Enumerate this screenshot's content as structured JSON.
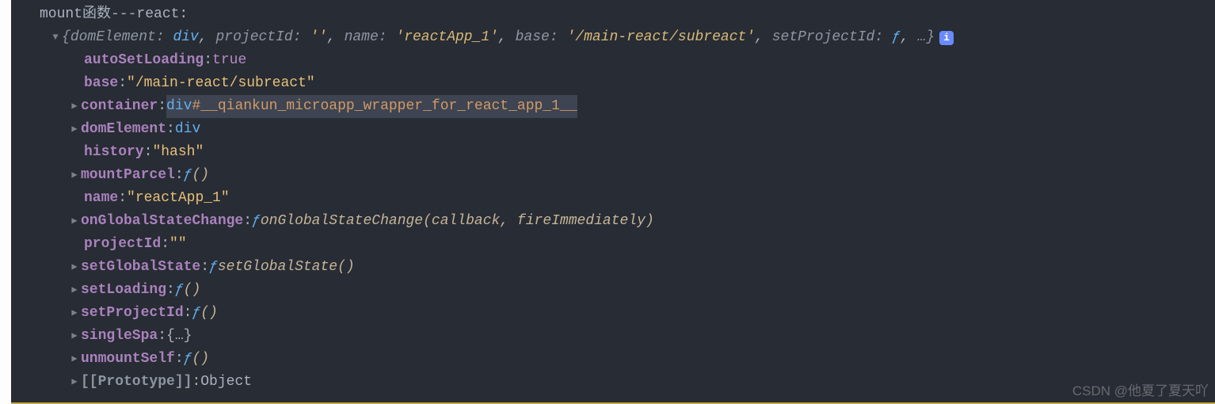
{
  "log_label": "mount函数---react:",
  "summary": {
    "open_brace": "{",
    "k1": "domElement:",
    "v1": "div",
    "c1": ",",
    "k2": "projectId:",
    "v2": "''",
    "c2": ",",
    "k3": "name:",
    "v3": "'reactApp_1'",
    "c3": ",",
    "k4": "base:",
    "v4": "'/main-react/subreact'",
    "c4": ",",
    "k5": "setProjectId:",
    "v5": "ƒ",
    "c5": ",",
    "rest": "…}",
    "info": "i"
  },
  "props": {
    "autoSetLoading": {
      "k": "autoSetLoading",
      "colon": ": ",
      "v": "true"
    },
    "base": {
      "k": "base",
      "colon": ": ",
      "v": "\"/main-react/subreact\""
    },
    "container": {
      "k": "container",
      "colon": ": ",
      "pre": "div",
      "sel": "#__qiankun_microapp_wrapper_for_react_app_1__"
    },
    "domElement": {
      "k": "domElement",
      "colon": ": ",
      "v": "div"
    },
    "history": {
      "k": "history",
      "colon": ": ",
      "v": "\"hash\""
    },
    "mountParcel": {
      "k": "mountParcel",
      "colon": ": ",
      "f": "ƒ ",
      "sig": "()"
    },
    "name": {
      "k": "name",
      "colon": ": ",
      "v": "\"reactApp_1\""
    },
    "onGlobalStateChange": {
      "k": "onGlobalStateChange",
      "colon": ": ",
      "f": "ƒ ",
      "sig": "onGlobalStateChange(callback, fireImmediately)"
    },
    "projectId": {
      "k": "projectId",
      "colon": ": ",
      "v": "\"\""
    },
    "setGlobalState": {
      "k": "setGlobalState",
      "colon": ": ",
      "f": "ƒ ",
      "sig": "setGlobalState()"
    },
    "setLoading": {
      "k": "setLoading",
      "colon": ": ",
      "f": "ƒ ",
      "sig": "()"
    },
    "setProjectId": {
      "k": "setProjectId",
      "colon": ": ",
      "f": "ƒ ",
      "sig": "()"
    },
    "singleSpa": {
      "k": "singleSpa",
      "colon": ": ",
      "v": "{…}"
    },
    "unmountSelf": {
      "k": "unmountSelf",
      "colon": ": ",
      "f": "ƒ ",
      "sig": "()"
    },
    "proto": {
      "k": "[[Prototype]]",
      "colon": ": ",
      "v": "Object"
    }
  },
  "watermark": "CSDN @他夏了夏天吖"
}
